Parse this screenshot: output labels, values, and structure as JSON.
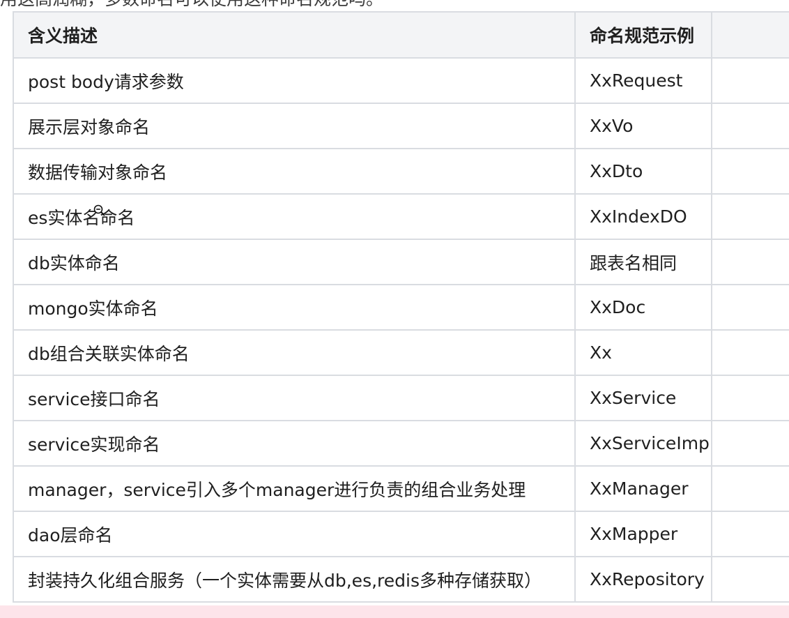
{
  "caption": "用这高润糊，多数命名可以使用这种命名规范吗。",
  "table": {
    "headers": [
      "含义描述",
      "命名规范示例",
      ""
    ],
    "rows": [
      [
        "post body请求参数",
        "XxRequest",
        ""
      ],
      [
        "展示层对象命名",
        "XxVo",
        ""
      ],
      [
        "数据传输对象命名",
        "XxDto",
        ""
      ],
      [
        "es实体名命名",
        "XxIndexDO",
        ""
      ],
      [
        "db实体命名",
        "跟表名相同",
        ""
      ],
      [
        "mongo实体命名",
        "XxDoc",
        ""
      ],
      [
        "db组合关联实体命名",
        "Xx",
        ""
      ],
      [
        "service接口命名",
        "XxService",
        ""
      ],
      [
        "service实现命名",
        "XxServiceImpl",
        ""
      ],
      [
        "manager，service引入多个manager进行负责的组合业务处理",
        "XxManager",
        ""
      ],
      [
        "dao层命名",
        "XxMapper",
        ""
      ],
      [
        "封装持久化组合服务（一个实体需要从db,es,redis多种存储获取）",
        "XxRepository",
        ""
      ]
    ]
  },
  "cursor": {
    "icon": "zoom-out-cursor-icon"
  }
}
